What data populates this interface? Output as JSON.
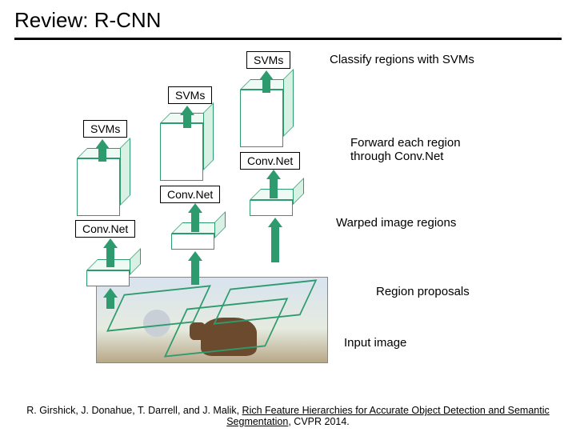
{
  "title": "Review: R-CNN",
  "labels": {
    "svms1": "SVMs",
    "svms2": "SVMs",
    "svms3": "SVMs",
    "conv1": "Conv.Net",
    "conv2": "Conv.Net",
    "conv3": "Conv.Net"
  },
  "annot": {
    "classify": "Classify regions with SVMs",
    "forward": "Forward each region through Conv.Net",
    "warped": "Warped image regions",
    "regionprop": "Region proposals",
    "inputimg": "Input image"
  },
  "citation": {
    "authors": "R. Girshick, J. Donahue, T. Darrell, and J. Malik, ",
    "paper_title": "Rich Feature Hierarchies for Accurate Object Detection and Semantic Segmentation",
    "venue": ", CVPR 2014."
  }
}
